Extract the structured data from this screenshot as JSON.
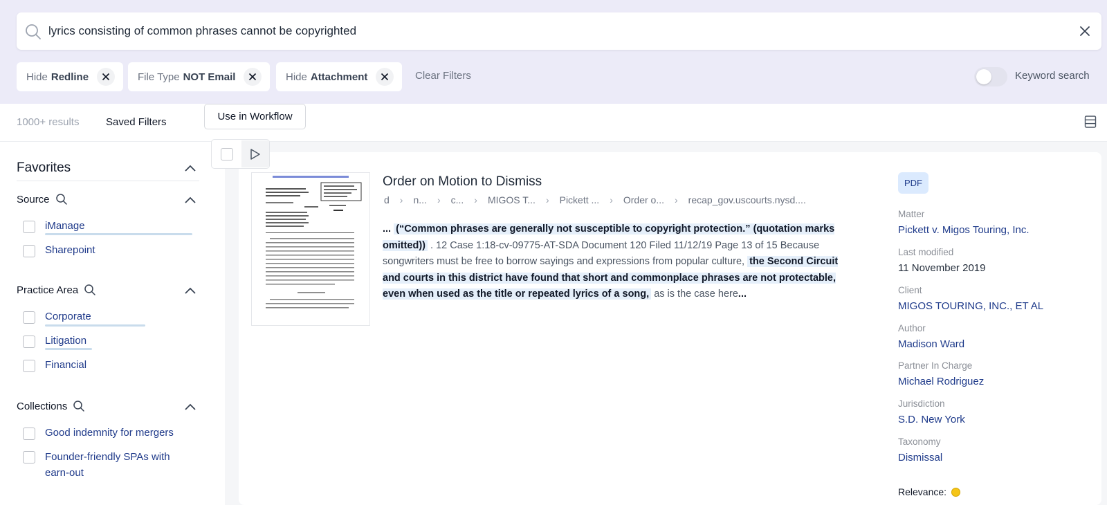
{
  "search": {
    "query": "lyrics consisting of common phrases cannot be copyrighted"
  },
  "filters": {
    "chips": [
      {
        "prefix": "Hide",
        "value": "Redline"
      },
      {
        "prefix": "File Type",
        "value": "NOT Email"
      },
      {
        "prefix": "Hide",
        "value": "Attachment"
      }
    ],
    "clear_label": "Clear Filters",
    "keyword_search_label": "Keyword search",
    "keyword_search_on": false
  },
  "results_bar": {
    "count": "1000+ results",
    "saved_filters": "Saved Filters",
    "workflow_button": "Use in Workflow"
  },
  "sidebar": {
    "favorites": "Favorites",
    "sections": [
      {
        "title": "Source",
        "items": [
          "iManage",
          "Sharepoint"
        ]
      },
      {
        "title": "Practice Area",
        "items": [
          "Corporate",
          "Litigation",
          "Financial"
        ]
      },
      {
        "title": "Collections",
        "items": [
          "Good indemnity for mergers",
          "Founder-friendly SPAs with earn-out"
        ]
      }
    ]
  },
  "result": {
    "title": "Order on Motion to Dismiss",
    "breadcrumbs": [
      "d",
      "n...",
      "c...",
      "MIGOS T...",
      "Pickett ...",
      "Order o...",
      "recap_gov.uscourts.nysd...."
    ],
    "snippet": {
      "lead": "...",
      "hl1": "(“Common phrases are generally not susceptible to copyright protection.” (quotation marks omitted))",
      "mid": ". 12 Case 1:18-cv-09775-AT-SDA Document 120 Filed 11/12/19 Page 13 of 15 Because songwriters must be free to borrow sayings and expressions from popular culture,",
      "hl2": "the Second Circuit and courts in this district have found that short and commonplace phrases are not protectable, even when used as the title or repeated lyrics of a song,",
      "tail": "as is the case here",
      "end": "..."
    },
    "file_type": "PDF",
    "meta": {
      "matter_label": "Matter",
      "matter": "Pickett v. Migos Touring, Inc.",
      "modified_label": "Last modified",
      "modified": "11 November 2019",
      "client_label": "Client",
      "client": "MIGOS TOURING, INC., ET AL",
      "author_label": "Author",
      "author": "Madison Ward",
      "partner_label": "Partner In Charge",
      "partner": "Michael Rodriguez",
      "jurisdiction_label": "Jurisdiction",
      "jurisdiction": "S.D. New York",
      "taxonomy_label": "Taxonomy",
      "taxonomy": "Dismissal",
      "relevance_label": "Relevance:"
    }
  },
  "colors": {
    "top_band": "#ecebf8",
    "link": "#1e3a8a",
    "highlight": "#e5effa",
    "relevance_dot": "#f5c518"
  }
}
